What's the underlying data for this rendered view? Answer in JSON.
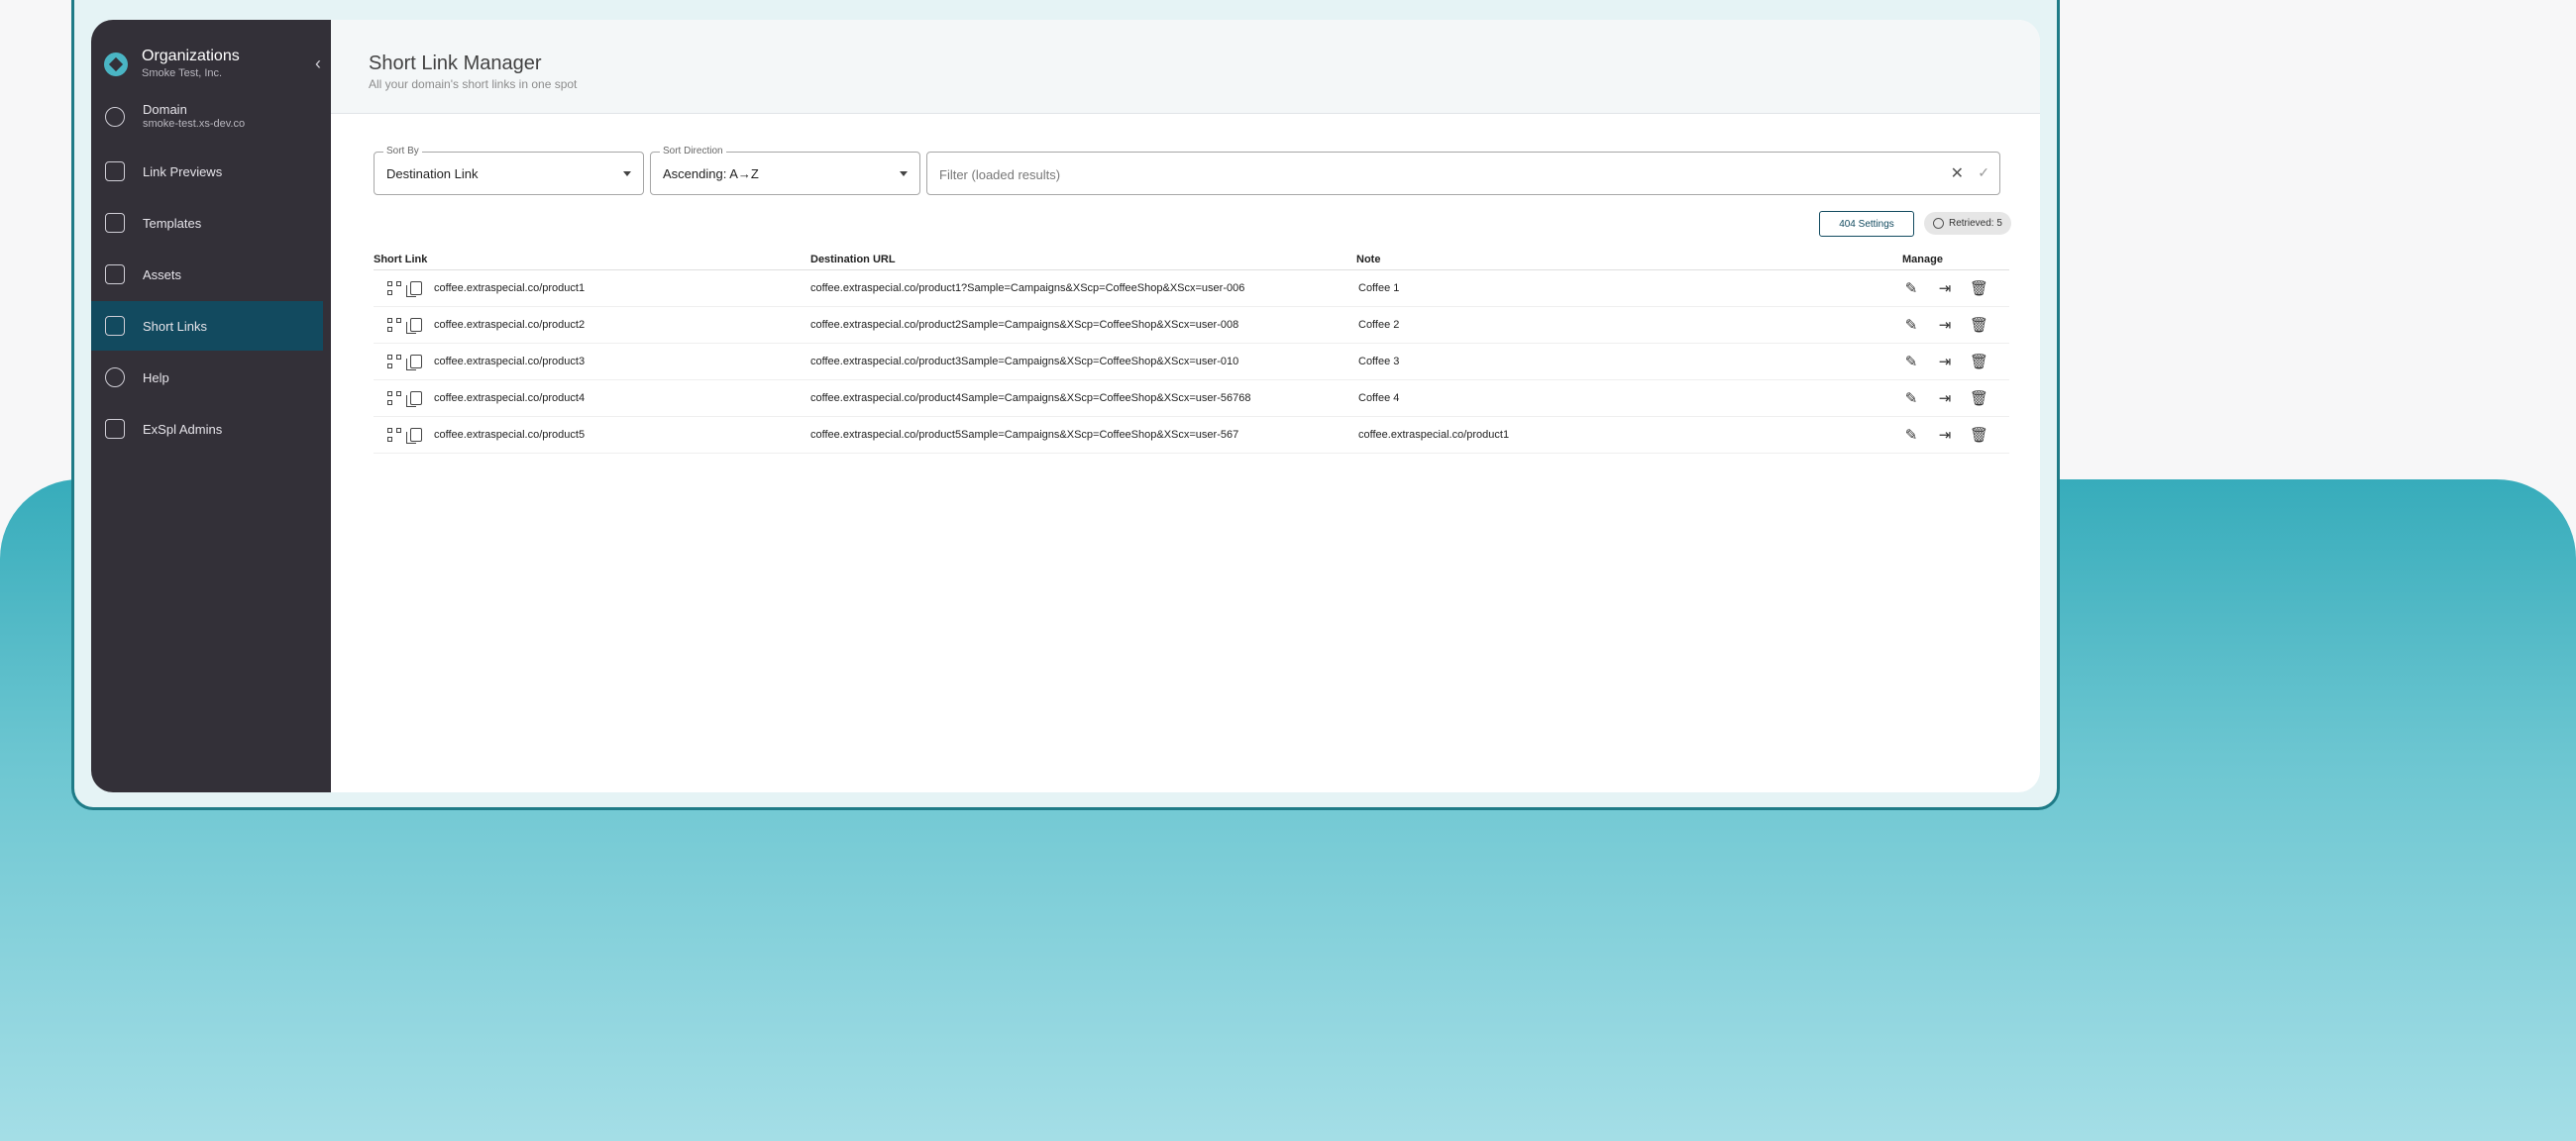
{
  "sidebar": {
    "org_title": "Organizations",
    "org_subtitle": "Smoke Test, Inc.",
    "items": [
      {
        "label": "Domain",
        "sublabel": "smoke-test.xs-dev.co",
        "icon": "globe-icon"
      },
      {
        "label": "Link Previews",
        "icon": "link-preview-icon"
      },
      {
        "label": "Templates",
        "icon": "layers-icon"
      },
      {
        "label": "Assets",
        "icon": "image-library-icon"
      },
      {
        "label": "Short Links",
        "icon": "short-link-icon",
        "active": true
      },
      {
        "label": "Help",
        "icon": "help-circle-icon"
      },
      {
        "label": "ExSpl Admins",
        "icon": "admin-settings-icon"
      }
    ]
  },
  "header": {
    "title": "Short Link Manager",
    "subtitle": "All your domain's short links in one spot"
  },
  "controls": {
    "sort_by_label": "Sort By",
    "sort_by_value": "Destination Link",
    "sort_dir_label": "Sort Direction",
    "sort_dir_value": "Ascending: A→Z",
    "filter_placeholder": "Filter (loaded results)"
  },
  "actions": {
    "settings_button": "404 Settings",
    "retrieved_chip": "Retrieved: 5"
  },
  "table": {
    "headers": [
      "Short Link",
      "Destination URL",
      "Note",
      "Manage"
    ],
    "rows": [
      {
        "short": "coffee.extraspecial.co/product1",
        "dest": "coffee.extraspecial.co/product1?Sample=Campaigns&XScp=CoffeeShop&XScx=user-006",
        "note": "Coffee 1"
      },
      {
        "short": "coffee.extraspecial.co/product2",
        "dest": "coffee.extraspecial.co/product2Sample=Campaigns&XScp=CoffeeShop&XScx=user-008",
        "note": "Coffee 2"
      },
      {
        "short": "coffee.extraspecial.co/product3",
        "dest": "coffee.extraspecial.co/product3Sample=Campaigns&XScp=CoffeeShop&XScx=user-010",
        "note": "Coffee 3"
      },
      {
        "short": "coffee.extraspecial.co/product4",
        "dest": "coffee.extraspecial.co/product4Sample=Campaigns&XScp=CoffeeShop&XScx=user-56768",
        "note": "Coffee 4"
      },
      {
        "short": "coffee.extraspecial.co/product5",
        "dest": "coffee.extraspecial.co/product5Sample=Campaigns&XScp=CoffeeShop&XScx=user-567",
        "note": "coffee.extraspecial.co/product1"
      }
    ]
  },
  "colors": {
    "sidebar_bg": "#333038",
    "active_item": "#124a5f",
    "accent": "#37acbb",
    "window_border": "#1f7b87"
  }
}
